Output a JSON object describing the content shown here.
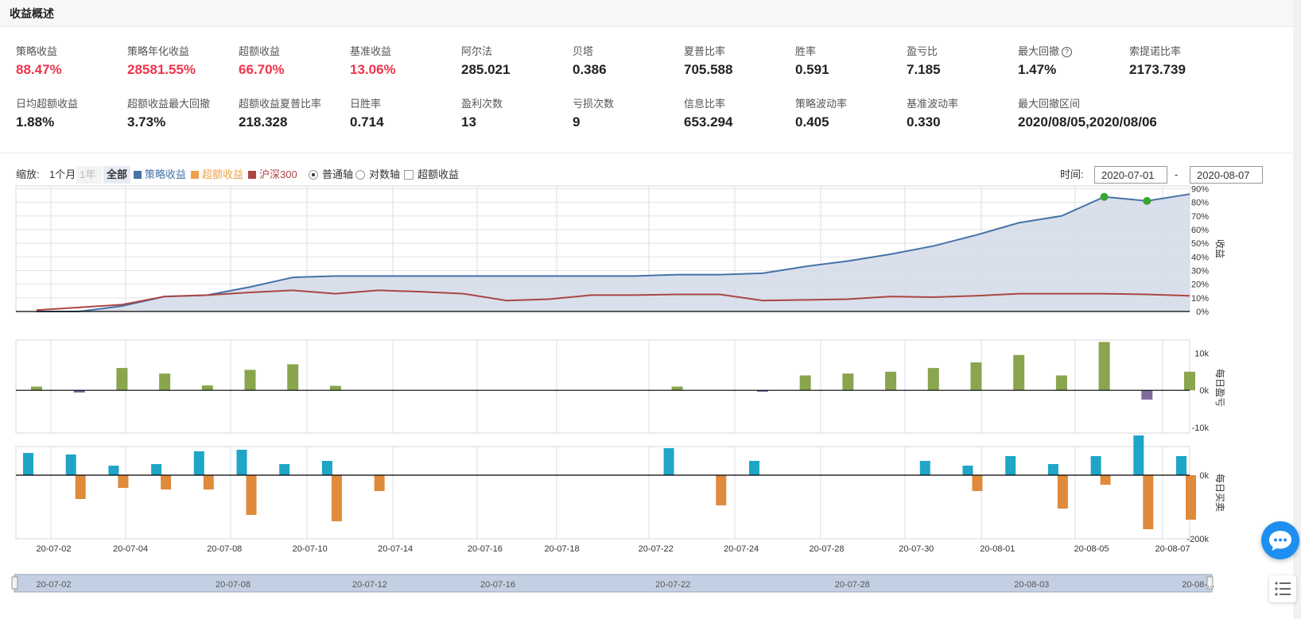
{
  "header": {
    "title": "收益概述"
  },
  "stats": [
    {
      "label": "策略收益",
      "value": "88.47%",
      "red": true
    },
    {
      "label": "策略年化收益",
      "value": "28581.55%",
      "red": true
    },
    {
      "label": "超额收益",
      "value": "66.70%",
      "red": true
    },
    {
      "label": "基准收益",
      "value": "13.06%",
      "red": true
    },
    {
      "label": "阿尔法",
      "value": "285.021"
    },
    {
      "label": "贝塔",
      "value": "0.386"
    },
    {
      "label": "夏普比率",
      "value": "705.588"
    },
    {
      "label": "胜率",
      "value": "0.591"
    },
    {
      "label": "盈亏比",
      "value": "7.185"
    },
    {
      "label": "最大回撤",
      "value": "1.47%",
      "help": true
    },
    {
      "label": "索提诺比率",
      "value": "2173.739"
    },
    {
      "label": "日均超额收益",
      "value": "1.88%"
    },
    {
      "label": "超额收益最大回撤",
      "value": "3.73%"
    },
    {
      "label": "超额收益夏普比率",
      "value": "218.328"
    },
    {
      "label": "日胜率",
      "value": "0.714"
    },
    {
      "label": "盈利次数",
      "value": "13"
    },
    {
      "label": "亏损次数",
      "value": "9"
    },
    {
      "label": "信息比率",
      "value": "653.294"
    },
    {
      "label": "策略波动率",
      "value": "0.405"
    },
    {
      "label": "基准波动率",
      "value": "0.330"
    },
    {
      "label": "最大回撤区间",
      "value": "2020/08/05,2020/08/06"
    }
  ],
  "controls": {
    "zoom_label": "缩放:",
    "zoom_options": [
      "1个月",
      "1年",
      "全部"
    ],
    "legend": [
      {
        "label": "策略收益",
        "color": "#4572a7"
      },
      {
        "label": "超额收益",
        "color": "#f0a04b"
      },
      {
        "label": "沪深300",
        "color": "#aa4643"
      }
    ],
    "axis_options": [
      "普通轴",
      "对数轴"
    ],
    "excess_checkbox": "超额收益",
    "time_label": "时间:",
    "date_from": "2020-07-01",
    "date_sep": "-",
    "date_to": "2020-08-07",
    "help_icon": "question-circle-icon"
  },
  "chart_data": [
    {
      "type": "area",
      "ylabel": "收益",
      "yticks": [
        "0%",
        "10%",
        "20%",
        "30%",
        "40%",
        "50%",
        "60%",
        "70%",
        "80%",
        "90%"
      ],
      "ylim": [
        0,
        92
      ],
      "x_index": [
        0,
        1,
        2,
        3,
        4,
        5,
        6,
        7,
        8,
        9,
        10,
        11,
        12,
        13,
        14,
        15,
        16,
        17,
        18,
        19,
        20,
        21,
        22,
        23,
        24,
        25,
        26,
        27
      ],
      "series": [
        {
          "name": "策略收益",
          "color": "#4572a7",
          "values": [
            0,
            0,
            4,
            11,
            12,
            18,
            25,
            26,
            26,
            26,
            26,
            26,
            26,
            26,
            26,
            27,
            27,
            28,
            33,
            37,
            42,
            48,
            56,
            65,
            70,
            84,
            81,
            86
          ],
          "markers": [
            25,
            26
          ]
        },
        {
          "name": "沪深300",
          "color": "#aa4643",
          "values": [
            1,
            3,
            5,
            11,
            12,
            14,
            15.5,
            13,
            15.5,
            14.5,
            13,
            8,
            9,
            12,
            12,
            12.5,
            12.5,
            8,
            8.5,
            9,
            11,
            10.5,
            11.5,
            13,
            13,
            13,
            12.5,
            11.5
          ]
        }
      ]
    },
    {
      "type": "bar",
      "ylabel": "每日盈亏",
      "yticks": [
        "-10k",
        "0k",
        "10k"
      ],
      "ylim": [
        -11.5,
        13.5
      ],
      "values": [
        {
          "day": 0,
          "value": 1
        },
        {
          "day": 1,
          "value": -0.6
        },
        {
          "day": 2,
          "value": 6
        },
        {
          "day": 3,
          "value": 4.5
        },
        {
          "day": 4,
          "value": 1.3
        },
        {
          "day": 5,
          "value": 5.5
        },
        {
          "day": 6,
          "value": 7
        },
        {
          "day": 7,
          "value": 1.2
        },
        {
          "day": 15,
          "value": 1
        },
        {
          "day": 17,
          "value": -0.4
        },
        {
          "day": 18,
          "value": 4
        },
        {
          "day": 19,
          "value": 4.5
        },
        {
          "day": 20,
          "value": 5
        },
        {
          "day": 21,
          "value": 6
        },
        {
          "day": 22,
          "value": 7.5
        },
        {
          "day": 23,
          "value": 9.5
        },
        {
          "day": 24,
          "value": 4
        },
        {
          "day": 25,
          "value": 13
        },
        {
          "day": 26,
          "value": -2.5
        },
        {
          "day": 27,
          "value": 5
        }
      ]
    },
    {
      "type": "bar",
      "ylabel": "每日买卖",
      "yticks": [
        "-200k",
        "0k"
      ],
      "ylim": [
        -200,
        90
      ],
      "series": [
        {
          "name": "buy",
          "color": "#1fa5c7",
          "values": [
            {
              "day": 0,
              "value": 70
            },
            {
              "day": 1,
              "value": 65
            },
            {
              "day": 2,
              "value": 30
            },
            {
              "day": 3,
              "value": 35
            },
            {
              "day": 4,
              "value": 75
            },
            {
              "day": 5,
              "value": 80
            },
            {
              "day": 6,
              "value": 35
            },
            {
              "day": 7,
              "value": 45
            },
            {
              "day": 15,
              "value": 85
            },
            {
              "day": 17,
              "value": 45
            },
            {
              "day": 21,
              "value": 45
            },
            {
              "day": 22,
              "value": 30
            },
            {
              "day": 23,
              "value": 60
            },
            {
              "day": 24,
              "value": 35
            },
            {
              "day": 25,
              "value": 60
            },
            {
              "day": 26,
              "value": 125
            },
            {
              "day": 27,
              "value": 60
            }
          ]
        },
        {
          "name": "sell",
          "color": "#e08a3c",
          "values": [
            {
              "day": 1,
              "value": -75
            },
            {
              "day": 2,
              "value": -40
            },
            {
              "day": 3,
              "value": -45
            },
            {
              "day": 4,
              "value": -45
            },
            {
              "day": 5,
              "value": -125
            },
            {
              "day": 7,
              "value": -145
            },
            {
              "day": 8,
              "value": -50
            },
            {
              "day": 16,
              "value": -95
            },
            {
              "day": 22,
              "value": -50
            },
            {
              "day": 24,
              "value": -105
            },
            {
              "day": 25,
              "value": -30
            },
            {
              "day": 26,
              "value": -170
            },
            {
              "day": 27,
              "value": -140
            }
          ]
        }
      ]
    }
  ],
  "x_axis_labels": [
    {
      "label": "20-07-02",
      "day": 0.4
    },
    {
      "label": "20-07-04",
      "day": 2.2
    },
    {
      "label": "20-07-08",
      "day": 4.4
    },
    {
      "label": "20-07-10",
      "day": 6.4
    },
    {
      "label": "20-07-14",
      "day": 8.4
    },
    {
      "label": "20-07-16",
      "day": 10.5
    },
    {
      "label": "20-07-18",
      "day": 12.3
    },
    {
      "label": "20-07-22",
      "day": 14.5
    },
    {
      "label": "20-07-24",
      "day": 16.5
    },
    {
      "label": "20-07-28",
      "day": 18.5
    },
    {
      "label": "20-07-30",
      "day": 20.6
    },
    {
      "label": "20-08-01",
      "day": 22.5
    },
    {
      "label": "20-08-05",
      "day": 24.7
    },
    {
      "label": "20-08-07",
      "day": 26.6
    }
  ],
  "navigator_labels": [
    {
      "label": "20-07-02",
      "day": 0.4
    },
    {
      "label": "20-07-08",
      "day": 4.6
    },
    {
      "label": "20-07-12",
      "day": 7.8
    },
    {
      "label": "20-07-16",
      "day": 10.8
    },
    {
      "label": "20-07-22",
      "day": 14.9
    },
    {
      "label": "20-07-28",
      "day": 19.1
    },
    {
      "label": "20-08-03",
      "day": 23.3
    },
    {
      "label": "20-08-...",
      "day": 27.2
    }
  ],
  "floating": {
    "chat_icon": "chat-bubble-icon",
    "list_icon": "list-icon"
  }
}
